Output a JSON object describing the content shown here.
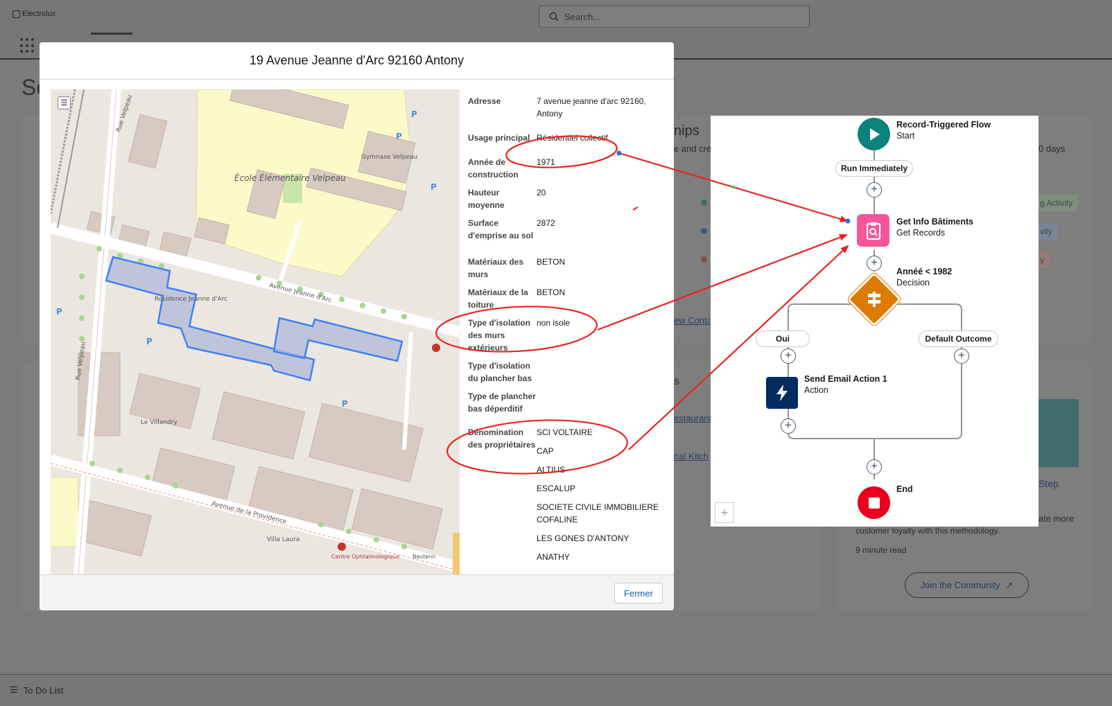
{
  "app": {
    "logo_text": "Electrolux",
    "search_placeholder": "Search...",
    "page_title_partial": "Se",
    "footer_todo": "To Do List"
  },
  "background": {
    "card_heading_partial": "nips",
    "card_text_partial": "e and cre",
    "days_text": "0 days",
    "activity_pill": "g Activity",
    "pill_2": "vity",
    "pill_3": "y",
    "view_contacts": "ew Conta",
    "link_1": "estaurant",
    "link_2": "nal Kitch",
    "section_letter": "s",
    "step_link": "Step",
    "promo_text_1": "ate more",
    "promo_text_2": "customer loyalty with this methodology.",
    "read_time": "9 minute read",
    "join_button": "Join the Community"
  },
  "modal": {
    "title": "19 Avenue Jeanne d'Arc 92160 Antony",
    "close_button": "Fermer",
    "fields": [
      {
        "label": "Adresse",
        "values": [
          "7 avenue jeanne d'arc 92160, Antony"
        ]
      },
      {
        "label": "Usage principal",
        "values": [
          "Résidentiel collectif"
        ]
      },
      {
        "label": "Année de construction",
        "values": [
          "1971"
        ]
      },
      {
        "label": "Hauteur moyenne",
        "values": [
          "20"
        ]
      },
      {
        "label": "Surface d'emprise au sol",
        "values": [
          "2872"
        ]
      },
      {
        "label": "Matériaux des murs",
        "values": [
          "BETON"
        ]
      },
      {
        "label": "Matériaux de la toiture",
        "values": [
          "BETON"
        ]
      },
      {
        "label": "Type d'isolation des murs extérieurs",
        "values": [
          "non isole"
        ]
      },
      {
        "label": "Type d'isolation du plancher bas",
        "values": []
      },
      {
        "label": "Type de plancher bas déperditif",
        "values": []
      },
      {
        "label": "Dénomination des propriétaires",
        "values": [
          "SCI VOLTAIRE",
          "CAP",
          "ALTIUS",
          "ESCALUP",
          "SOCIETE CIVILE IMMOBILIERE COFALINE",
          "LES GONES D'ANTONY",
          "ANATHY"
        ]
      }
    ]
  },
  "map": {
    "labels": {
      "school": "École Élémentaire Velpeau",
      "gym": "Gymnase Velpeau",
      "residence": "Résidence Jeanne d'Arc",
      "street_velpeau_top": "Rue Velpeau",
      "street_velpeau_bottom": "Rue Velpeau",
      "street_jeanne": "Avenue Jeanne d'Arc",
      "street_providence": "Avenue de la Providence",
      "villandry": "Le Villandry",
      "villa_laura": "Villa Laura",
      "centre": "Centre Ophtalmologique",
      "nestenn": "Nestenn"
    }
  },
  "flow": {
    "start_title": "Record-Triggered Flow",
    "start_sub": "Start",
    "run_label": "Run Immediately",
    "get_title": "Get Info Bâtiments",
    "get_sub": "Get Records",
    "decision_title": "Annéé < 1982",
    "decision_sub": "Decision",
    "branch_yes": "Oui",
    "branch_default": "Default Outcome",
    "action_title": "Send Email Action 1",
    "action_sub": "Action",
    "end_title": "End"
  },
  "colors": {
    "annotation_red": "#e8231f",
    "start_green": "#0b827c",
    "get_pink": "#f5559a",
    "decision_orange": "#dd7a01",
    "action_navy": "#032d60",
    "end_red": "#ea001e"
  }
}
